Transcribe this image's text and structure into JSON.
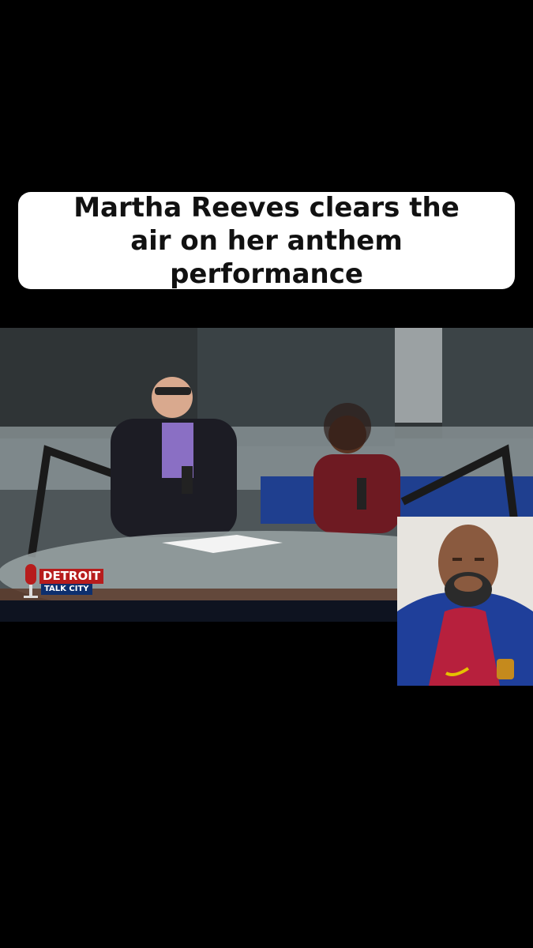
{
  "caption": {
    "line1": "Martha Reeves clears the",
    "line2": "air on her anthem performance"
  },
  "video": {
    "logo": {
      "line1": "DETROIT",
      "line2": "TALK CITY"
    }
  },
  "colors": {
    "background": "#000000",
    "caption_bg": "#ffffff",
    "caption_text": "#111111",
    "logo_red": "#b71c1c",
    "logo_blue": "#0d2f6e"
  }
}
